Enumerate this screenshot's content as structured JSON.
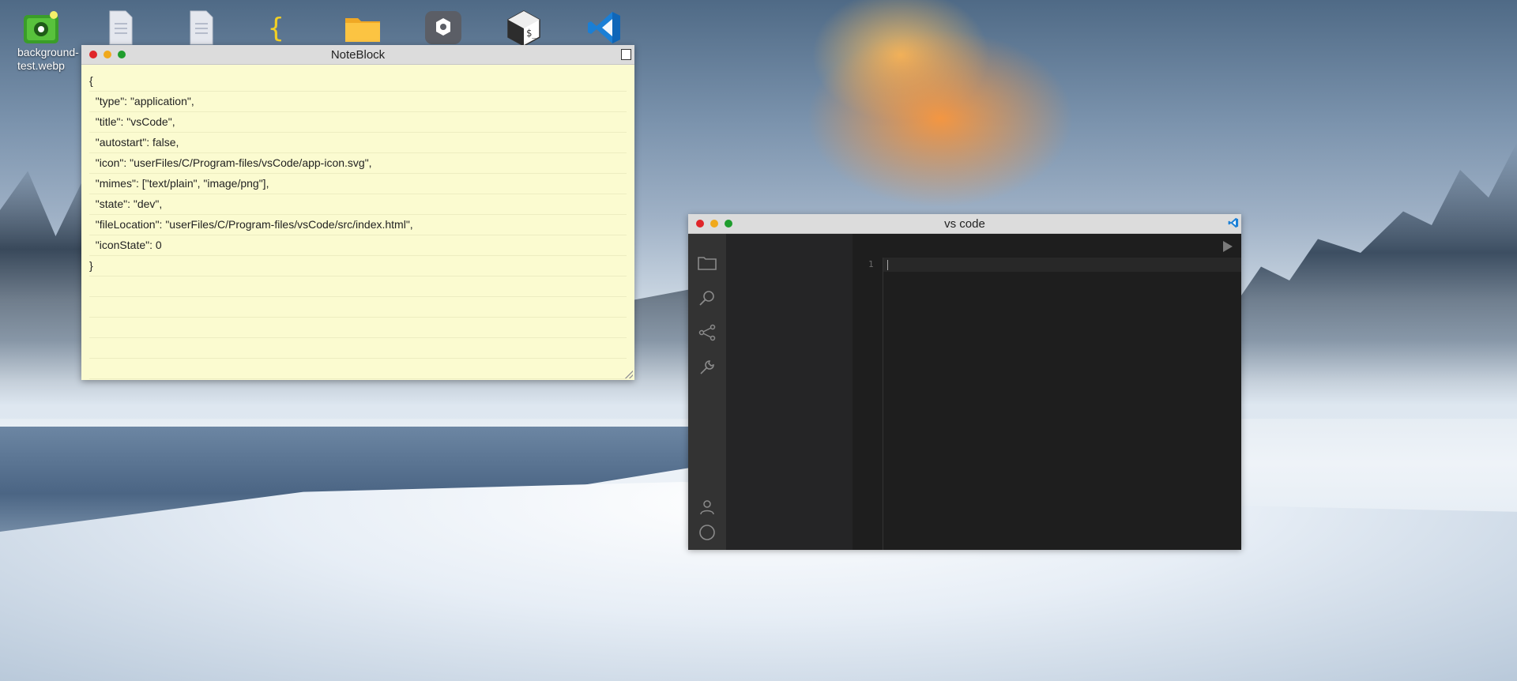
{
  "desktop": {
    "icons": [
      {
        "name": "background-test-webp",
        "label": "background-\ntest.webp",
        "icon": "image-file-icon"
      },
      {
        "name": "text-file-1",
        "label": "",
        "icon": "document-icon"
      },
      {
        "name": "text-file-2",
        "label": "",
        "icon": "document-icon"
      },
      {
        "name": "json-file",
        "label": "",
        "icon": "curly-braces-icon"
      },
      {
        "name": "folder",
        "label": "",
        "icon": "folder-icon"
      },
      {
        "name": "settings-app",
        "label": "",
        "icon": "settings-icon"
      },
      {
        "name": "terminal-app",
        "label": "",
        "icon": "terminal-icon"
      },
      {
        "name": "vscode-app",
        "label": "",
        "icon": "vscode-icon"
      }
    ]
  },
  "noteblock": {
    "title": "NoteBlock",
    "lines": [
      "{",
      "  \"type\": \"application\",",
      "  \"title\": \"vsCode\",",
      "  \"autostart\": false,",
      "  \"icon\": \"userFiles/C/Program-files/vsCode/app-icon.svg\",",
      "  \"mimes\": [\"text/plain\", \"image/png\"],",
      "  \"state\": \"dev\",",
      "  \"fileLocation\": \"userFiles/C/Program-files/vsCode/src/index.html\",",
      "  \"iconState\": 0",
      "}"
    ]
  },
  "vscode": {
    "title": "vs code",
    "line_number": "1",
    "activity_icons": [
      "folder-icon",
      "search-icon",
      "source-control-icon",
      "wrench-icon"
    ],
    "activity_bottom_icons": [
      "account-icon",
      "circle-icon"
    ]
  },
  "colors": {
    "note_bg": "#fbfbd0",
    "titlebar": "#dcdcdc",
    "close": "#e0262a",
    "minimize": "#f0a91c",
    "maximize": "#1f9d2d",
    "vs_accent": "#0078d4"
  }
}
